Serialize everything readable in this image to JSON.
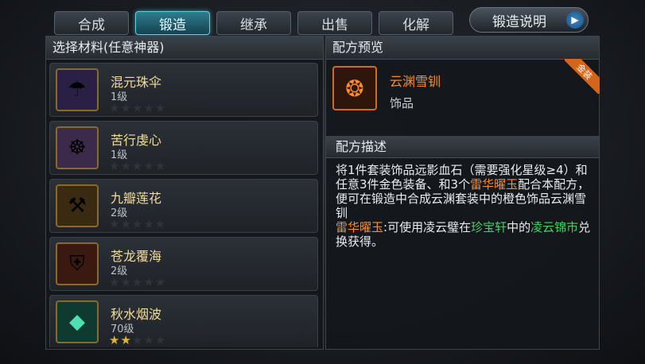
{
  "tabs": [
    {
      "label": "合成"
    },
    {
      "label": "锻造"
    },
    {
      "label": "继承"
    },
    {
      "label": "出售"
    },
    {
      "label": "化解"
    }
  ],
  "help_button": {
    "label": "锻造说明"
  },
  "materials_panel": {
    "title": "选择材料(任意神器)",
    "items": [
      {
        "name": "混元珠伞",
        "level": "1级",
        "stars_filled": 0,
        "stars_total": 5,
        "icon": "umbrella-icon"
      },
      {
        "name": "苦行虔心",
        "level": "1级",
        "stars_filled": 0,
        "stars_total": 5,
        "icon": "monk-icon"
      },
      {
        "name": "九瓣莲花",
        "level": "2级",
        "stars_filled": 0,
        "stars_total": 5,
        "icon": "hammer-icon"
      },
      {
        "name": "苍龙覆海",
        "level": "2级",
        "stars_filled": 0,
        "stars_total": 5,
        "icon": "dragon-armor-icon"
      },
      {
        "name": "秋水烟波",
        "level": "70级",
        "stars_filled": 2,
        "stars_total": 5,
        "icon": "jade-icon"
      }
    ]
  },
  "recipe_preview": {
    "title": "配方预览",
    "item_name": "云渊雪钏",
    "item_type": "饰品",
    "badge": "金装",
    "icon": "bracelet-icon"
  },
  "recipe_desc": {
    "title": "配方描述",
    "text_1": "将1件套装饰品远影血石（需要强化星级≥4）和任意3件金色装备、和3个",
    "hl_1": "雷华曜玉",
    "text_2": "配合本配方，便可在锻造中合成云渊套装中的橙色饰品云渊雪钏",
    "hl_2": "雷华曜玉",
    "text_3": ":可使用凌云璧在",
    "hl_3": "珍宝轩",
    "text_4": "中的",
    "hl_4": "凌云锦市",
    "text_5": "兑换获得。"
  },
  "colors": {
    "active_tab": "#2f7c8f",
    "item_name": "#f2dc9c",
    "orange": "#ff8a2a",
    "green": "#43d06a"
  }
}
